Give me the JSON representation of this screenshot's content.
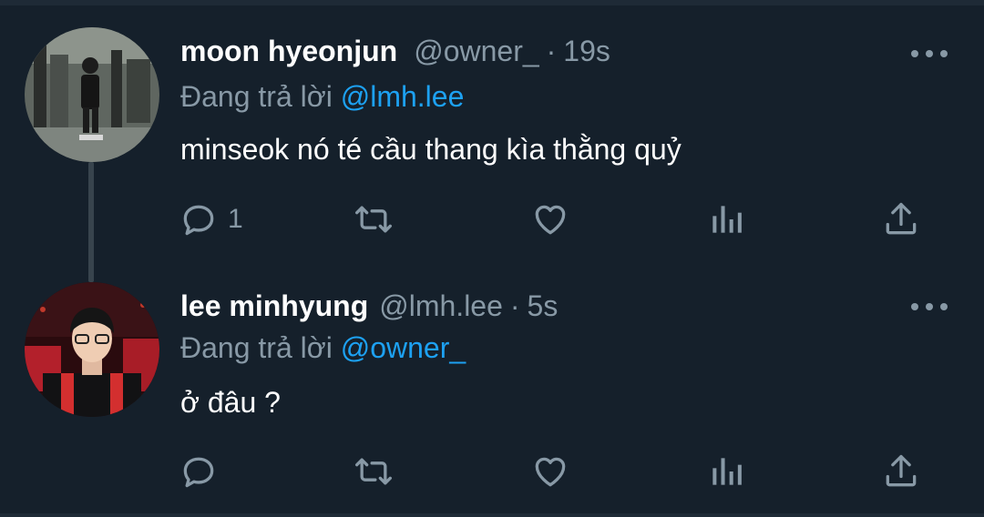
{
  "tweets": [
    {
      "name": "moon hyeonjun",
      "handle": "@owner_",
      "dot": "·",
      "time": "19s",
      "reply_prefix": "Đang trả lời",
      "reply_to": "@lmh.lee",
      "text": "minseok nó té cầu thang kìa thằng quỷ",
      "reply_count": "1"
    },
    {
      "name": "lee minhyung",
      "handle": "@lmh.lee",
      "dot": "·",
      "time": "5s",
      "reply_prefix": "Đang trả lời",
      "reply_to": "@owner_",
      "text": "ở đâu ?",
      "reply_count": ""
    }
  ],
  "icons": {
    "reply": "reply-icon",
    "retweet": "retweet-icon",
    "like": "heart-icon",
    "analytics": "analytics-icon",
    "share": "share-icon",
    "more": "more-options-icon"
  },
  "colors": {
    "background": "#15202b",
    "secondary_text": "#8899a6",
    "mention": "#1da1f2",
    "thread_line": "#38444d"
  }
}
